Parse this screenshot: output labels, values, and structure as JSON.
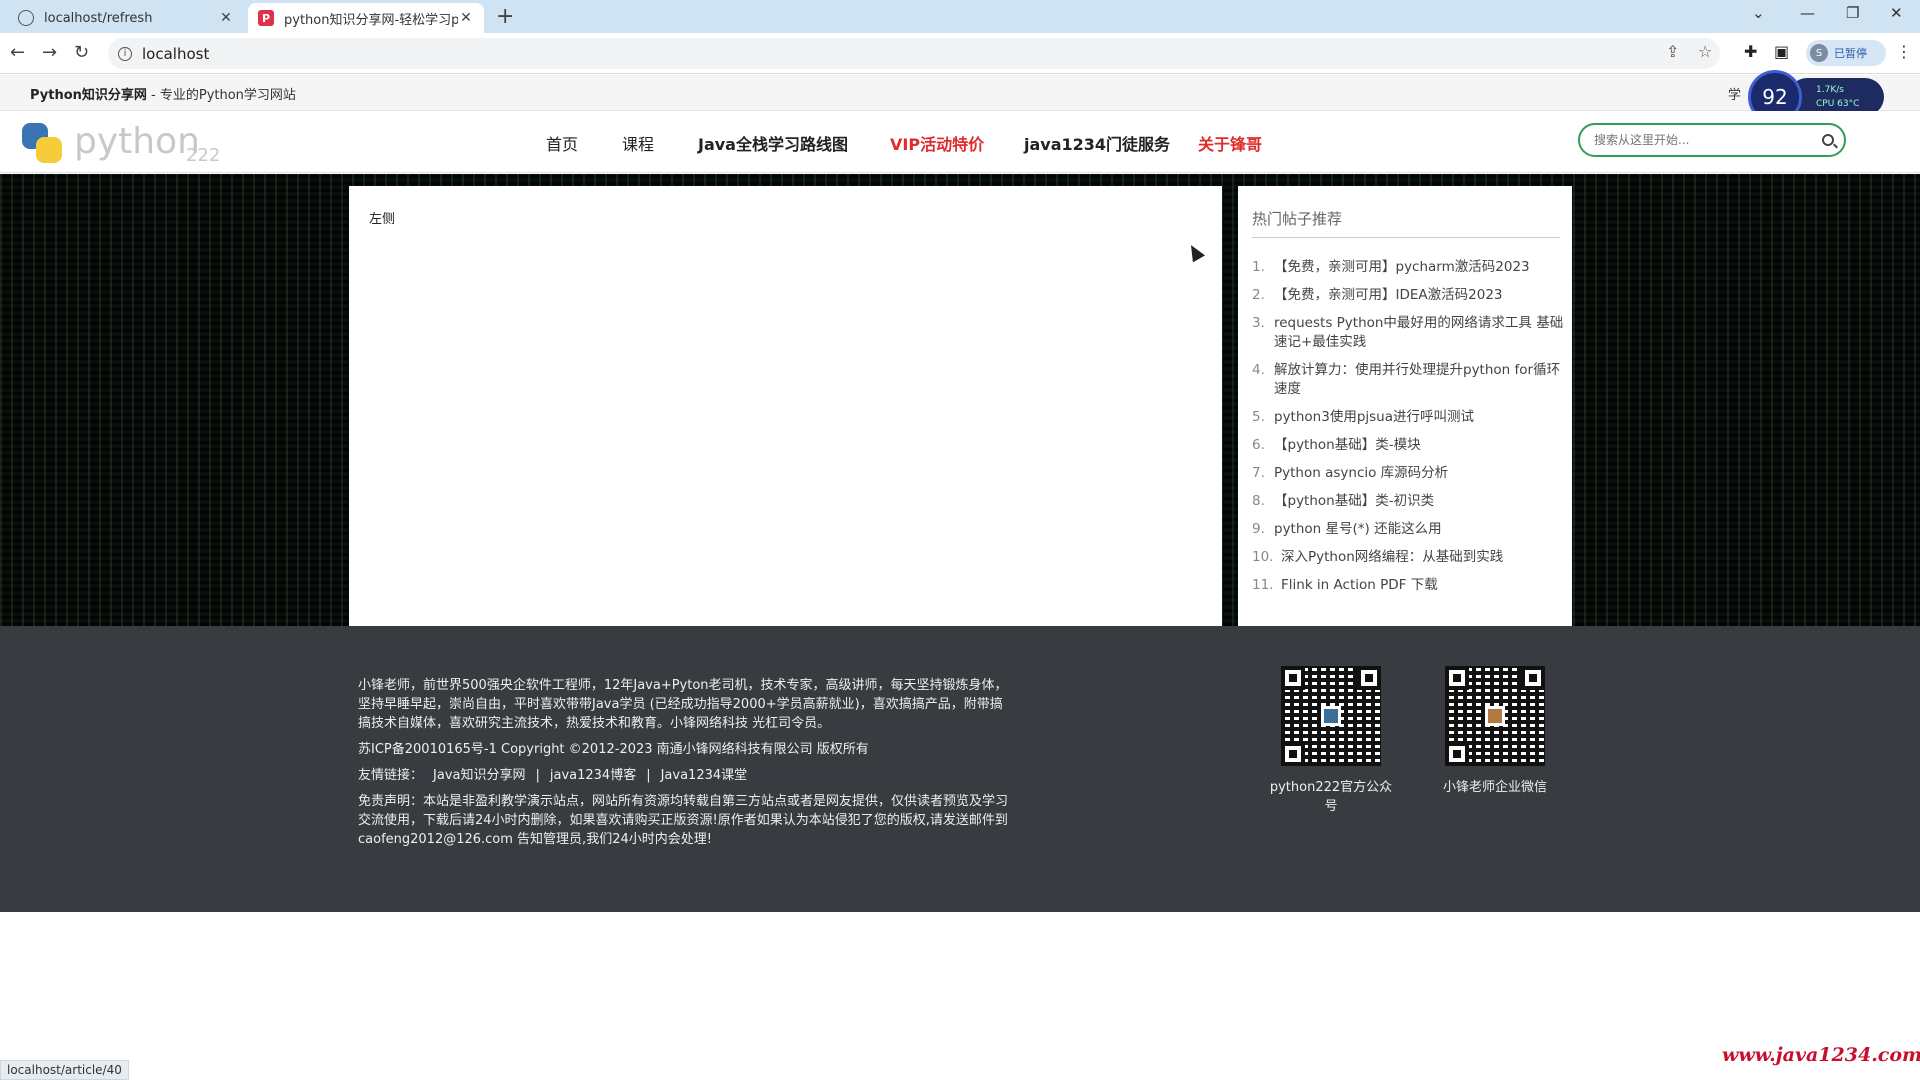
{
  "browser": {
    "tabs": [
      {
        "title": "localhost/refresh",
        "active": false
      },
      {
        "title": "python知识分享网-轻松学习pyt",
        "active": true
      }
    ],
    "new_tab": "+",
    "address": "localhost",
    "profile_label": "已暂停",
    "profile_initial": "S",
    "status_url": "localhost/article/40"
  },
  "site": {
    "name": "Python知识分享网",
    "tagline": " - 专业的Python学习网站",
    "topstrip_right": "学",
    "logo_word": "python",
    "logo_num": "222",
    "nav": [
      "首页",
      "课程",
      "Java全栈学习路线图",
      "VIP活动特价",
      "java1234门徒服务",
      "关于锋哥"
    ],
    "search_placeholder": "搜索从这里开始..."
  },
  "speed_widget": {
    "value": "92",
    "line1": "1.7K/s",
    "line2": "CPU 63°C"
  },
  "article": {
    "text": "左侧"
  },
  "sidebar": {
    "heading": "热门帖子推荐",
    "items": [
      {
        "n": "1.",
        "t": "【免费，亲测可用】pycharm激活码2023"
      },
      {
        "n": "2.",
        "t": "【免费，亲测可用】IDEA激活码2023"
      },
      {
        "n": "3.",
        "t": "requests Python中最好用的网络请求工具 基础速记+最佳实践"
      },
      {
        "n": "4.",
        "t": "解放计算力：使用并行处理提升python for循环速度"
      },
      {
        "n": "5.",
        "t": "python3使用pjsua进行呼叫测试"
      },
      {
        "n": "6.",
        "t": "【python基础】类-模块"
      },
      {
        "n": "7.",
        "t": "Python asyncio 库源码分析"
      },
      {
        "n": "8.",
        "t": "【python基础】类-初识类"
      },
      {
        "n": "9.",
        "t": "python 星号(*) 还能这么用"
      },
      {
        "n": "10.",
        "t": "深入Python网络编程：从基础到实践"
      },
      {
        "n": "11.",
        "t": "Flink in Action PDF 下载"
      }
    ]
  },
  "footer": {
    "about": "小锋老师，前世界500强央企软件工程师，12年Java+Pyton老司机，技术专家，高级讲师，每天坚持锻炼身体，坚持早睡早起，崇尚自由，平时喜欢带带Java学员 (已经成功指导2000+学员高薪就业)，喜欢搞搞产品，附带搞搞技术自媒体，喜欢研究主流技术，热爱技术和教育。小锋网络科技 光杠司令员。",
    "icp": "苏ICP备20010165号-1 Copyright ©2012-2023 南通小锋网络科技有限公司 版权所有",
    "links_label": "友情链接：",
    "links": [
      "Java知识分享网",
      "|",
      "java1234博客",
      "|",
      "Java1234课堂"
    ],
    "disclaimer": "免责声明：本站是非盈利教学演示站点，网站所有资源均转载自第三方站点或者是网友提供，仅供读者预览及学习交流使用，下载后请24小时内删除，如果喜欢请购买正版资源!原作者如果认为本站侵犯了您的版权,请发送邮件到 caofeng2012@126.com 告知管理员,我们24小时内会处理!",
    "qr1_label": "python222官方公众号",
    "qr2_label": "小锋老师企业微信"
  },
  "watermark": "www.java1234.com"
}
